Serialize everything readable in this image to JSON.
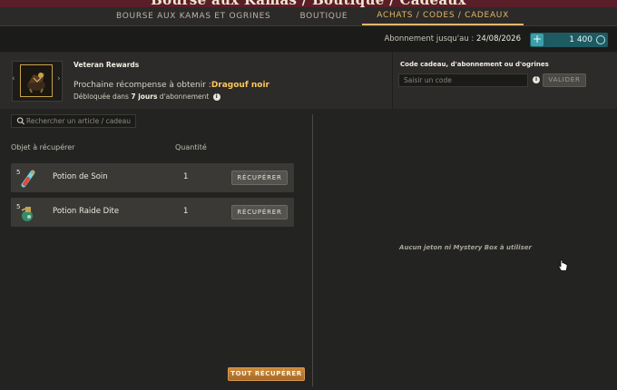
{
  "window": {
    "title": "Bourse aux Kamas / Boutique / Cadeaux"
  },
  "tabs": [
    {
      "label": "BOURSE AUX KAMAS ET OGRINES",
      "active": false
    },
    {
      "label": "BOUTIQUE",
      "active": false
    },
    {
      "label": "ACHATS / CODES / CADEAUX",
      "active": true
    }
  ],
  "subscription": {
    "label": "Abonnement jusqu'au :",
    "date": "24/08/2026"
  },
  "ogrines": {
    "plus": "+",
    "amount": "1 400"
  },
  "rewards": {
    "title": "Veteran Rewards",
    "next_prefix": "Prochaine récompense à obtenir :",
    "next_name": "Dragouf noir",
    "unlock_prefix": "Débloquée dans ",
    "unlock_days": "7 jours",
    "unlock_suffix": " d'abonnement",
    "arrow_left": "‹",
    "arrow_right": "›"
  },
  "gift": {
    "title": "Code cadeau, d'abonnement ou d'ogrines",
    "placeholder": "Saisir un code",
    "validate": "VALIDER"
  },
  "search": {
    "placeholder": "Rechercher un article / cadeau"
  },
  "columns": {
    "item": "Objet à récupérer",
    "qty": "Quantité"
  },
  "items": [
    {
      "name": "Potion de Soin",
      "qty": "1",
      "level": "5",
      "button": "RÉCUPÉRER",
      "icon": "potion-heal-icon"
    },
    {
      "name": "Potion Raide Dite",
      "qty": "1",
      "level": "5",
      "button": "RÉCUPÉRER",
      "icon": "potion-raide-icon"
    }
  ],
  "empty_message": "Aucun jeton ni Mystery Box à utiliser",
  "recover_all": "TOUT RÉCUPÉRER",
  "colors": {
    "accent": "#e4b56a",
    "reward_name": "#ffc65a",
    "ogrines_bg": "#1e5a62",
    "action_orange": "#c98a3a"
  }
}
